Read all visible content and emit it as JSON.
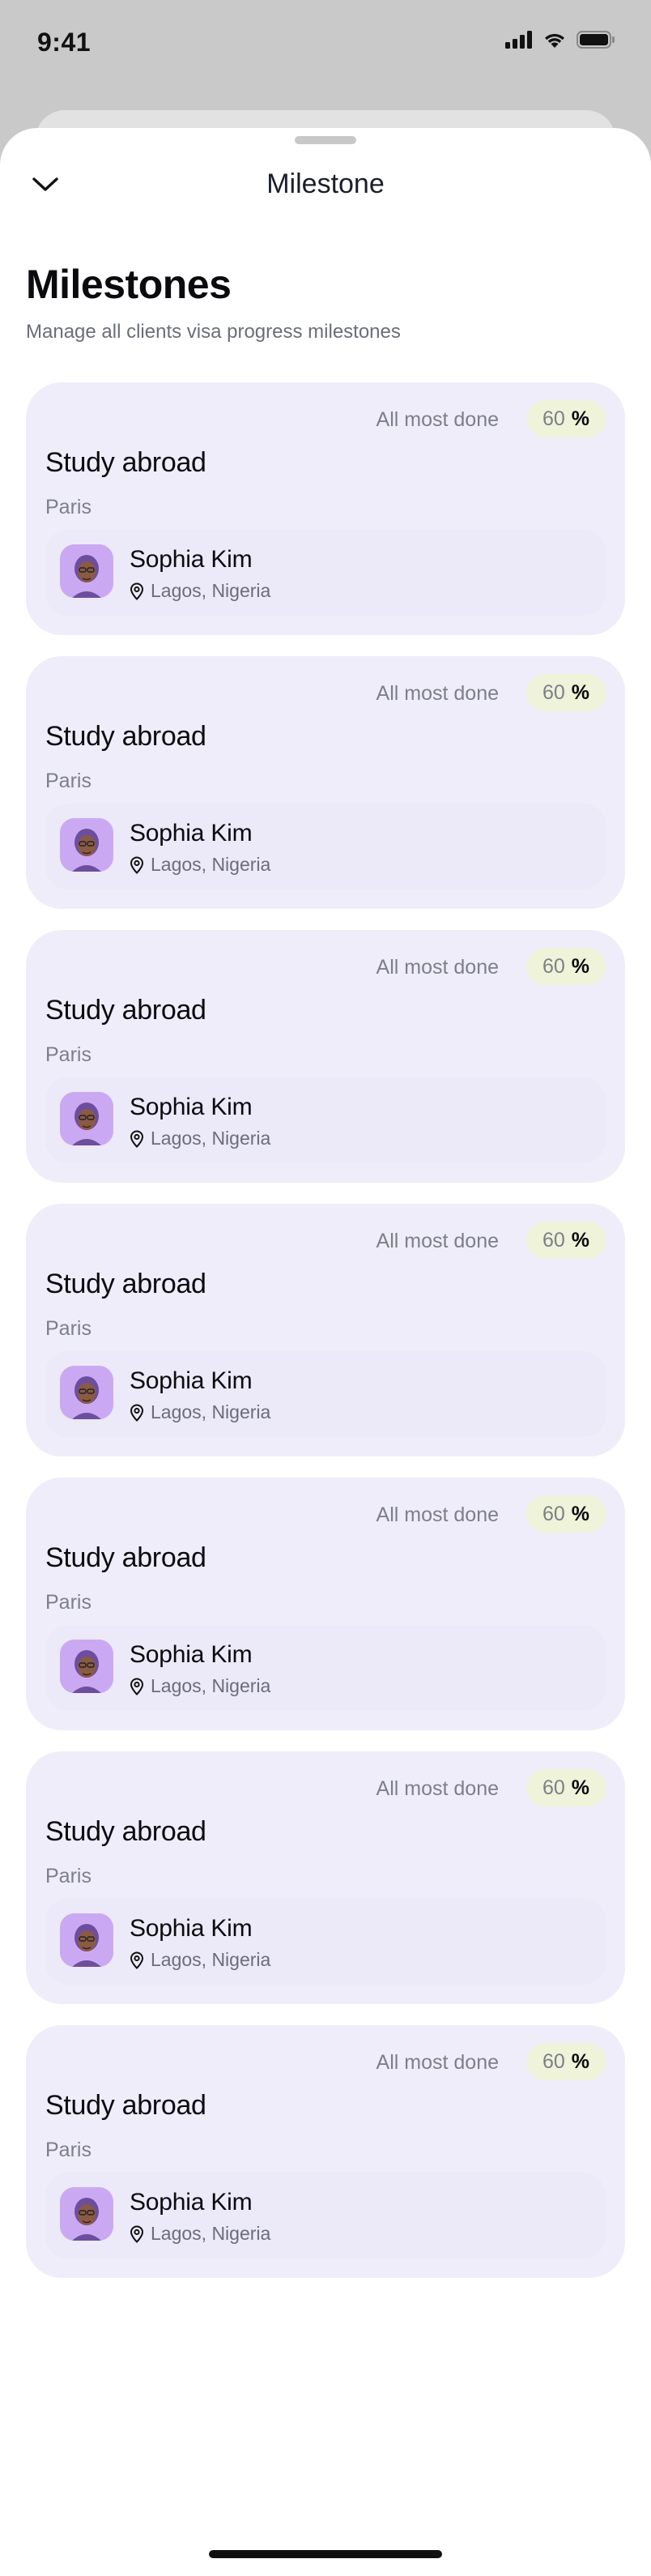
{
  "status_bar": {
    "time": "9:41",
    "icons": [
      "cellular-signal-icon",
      "wifi-icon",
      "battery-icon"
    ]
  },
  "header": {
    "title": "Milestone",
    "back_icon": "chevron-down-icon"
  },
  "page": {
    "title": "Milestones",
    "subtitle": "Manage all clients visa progress milestones"
  },
  "colors": {
    "card_bg": "#efedfa",
    "badge_bg": "#eef3d9",
    "avatar_bg": "#cba9f2"
  },
  "milestones": [
    {
      "status": "All most done",
      "percent": "60",
      "percent_sign": "%",
      "title": "Study abroad",
      "city": "Paris",
      "client": {
        "name": "Sophia Kim",
        "location": "Lagos, Nigeria"
      }
    },
    {
      "status": "All most done",
      "percent": "60",
      "percent_sign": "%",
      "title": "Study abroad",
      "city": "Paris",
      "client": {
        "name": "Sophia Kim",
        "location": "Lagos, Nigeria"
      }
    },
    {
      "status": "All most done",
      "percent": "60",
      "percent_sign": "%",
      "title": "Study abroad",
      "city": "Paris",
      "client": {
        "name": "Sophia Kim",
        "location": "Lagos, Nigeria"
      }
    },
    {
      "status": "All most done",
      "percent": "60",
      "percent_sign": "%",
      "title": "Study abroad",
      "city": "Paris",
      "client": {
        "name": "Sophia Kim",
        "location": "Lagos, Nigeria"
      }
    },
    {
      "status": "All most done",
      "percent": "60",
      "percent_sign": "%",
      "title": "Study abroad",
      "city": "Paris",
      "client": {
        "name": "Sophia Kim",
        "location": "Lagos, Nigeria"
      }
    },
    {
      "status": "All most done",
      "percent": "60",
      "percent_sign": "%",
      "title": "Study abroad",
      "city": "Paris",
      "client": {
        "name": "Sophia Kim",
        "location": "Lagos, Nigeria"
      }
    },
    {
      "status": "All most done",
      "percent": "60",
      "percent_sign": "%",
      "title": "Study abroad",
      "city": "Paris",
      "client": {
        "name": "Sophia Kim",
        "location": "Lagos, Nigeria"
      }
    }
  ]
}
